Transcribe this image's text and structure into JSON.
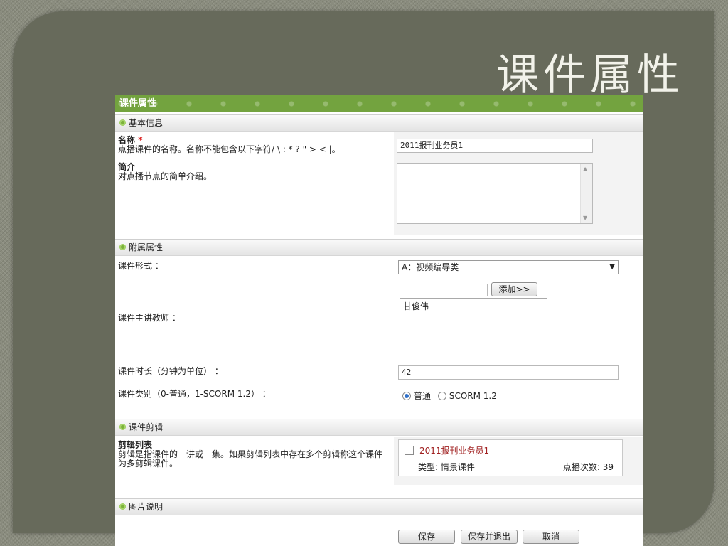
{
  "slide": {
    "title": "课件属性"
  },
  "form": {
    "header": "课件属性",
    "sections": {
      "basic": "基本信息",
      "extra": "附属属性",
      "clip": "课件剪辑",
      "image": "图片说明"
    },
    "name": {
      "label": "名称",
      "required_mark": "*",
      "hint": "点播课件的名称。名称不能包含以下字符/ \\ : * ? \" > < |。",
      "value": "2011报刊业务员1"
    },
    "intro": {
      "label": "简介",
      "hint": "对点播节点的简单介绍。",
      "value": ""
    },
    "format": {
      "label": "课件形式 ：",
      "selected": "A：视频编导类"
    },
    "teacher": {
      "label": "课件主讲教师 ：",
      "input_value": "",
      "add_button": "添加>>",
      "list": [
        "甘俊伟"
      ]
    },
    "duration": {
      "label": "课件时长（分钟为单位） ：",
      "value": "42"
    },
    "category": {
      "label": "课件类别（0-普通，1-SCORM 1.2） ：",
      "options": [
        {
          "label": "普通",
          "checked": true
        },
        {
          "label": "SCORM 1.2",
          "checked": false
        }
      ]
    },
    "clips": {
      "label": "剪辑列表",
      "hint": "剪辑是指课件的一讲或一集。如果剪辑列表中存在多个剪辑称这个课件为多剪辑课件。",
      "items": [
        {
          "name": "2011报刊业务员1",
          "type": "类型: 情景课件",
          "plays": "点播次数: 39"
        }
      ]
    },
    "buttons": {
      "save": "保存",
      "save_exit": "保存并退出",
      "cancel": "取消"
    }
  },
  "colors": {
    "header_green": "#73a33f",
    "slide_bg": "#676a5b",
    "section_dot": "#7bb13a"
  }
}
